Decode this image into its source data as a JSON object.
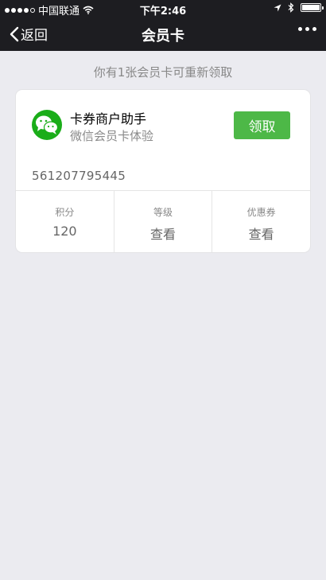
{
  "status_bar": {
    "carrier": "中国联通",
    "time": "下午2:46",
    "signal_bars": 4,
    "battery_level": 1.0
  },
  "nav": {
    "back_label": "返回",
    "title": "会员卡"
  },
  "notice": "你有1张会员卡可重新领取",
  "card": {
    "title": "卡券商户助手",
    "subtitle": "微信会员卡体验",
    "claim_label": "领取",
    "number": "561207795445",
    "stats": [
      {
        "label": "积分",
        "value": "120"
      },
      {
        "label": "等级",
        "value": "查看"
      },
      {
        "label": "优惠券",
        "value": "查看"
      }
    ]
  },
  "colors": {
    "nav_background": "#1d1d21",
    "page_background": "#ebebf0",
    "accent_green": "#4db847",
    "logo_green": "#1aad19"
  }
}
